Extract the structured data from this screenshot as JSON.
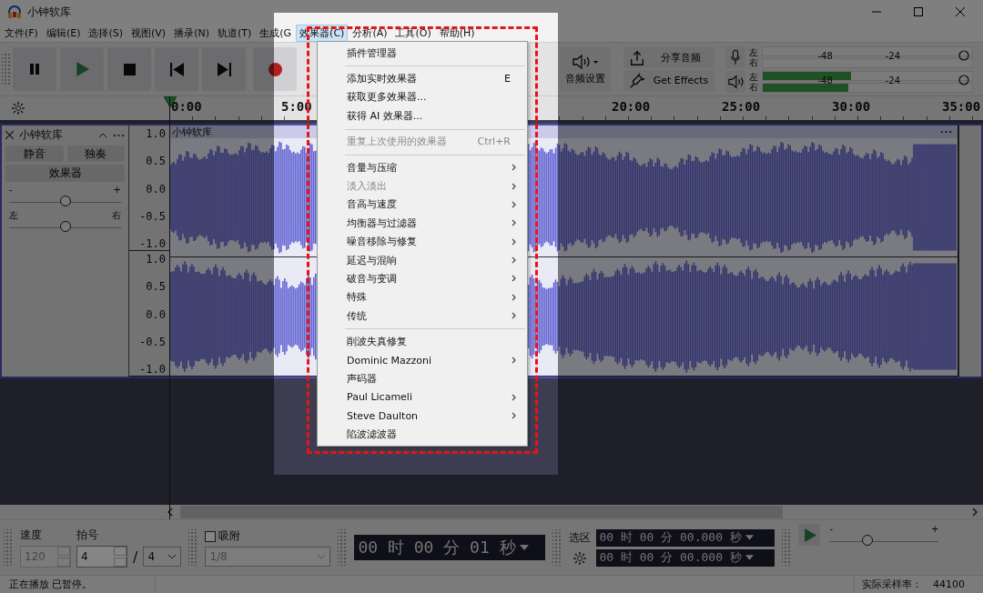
{
  "window": {
    "title": "小钟软库"
  },
  "menubar": [
    {
      "label": "文件(F)",
      "selected": false
    },
    {
      "label": "编辑(E)",
      "selected": false
    },
    {
      "label": "选择(S)",
      "selected": false
    },
    {
      "label": "视图(V)",
      "selected": false
    },
    {
      "label": "播录(N)",
      "selected": false
    },
    {
      "label": "轨道(T)",
      "selected": false
    },
    {
      "label": "生成(G",
      "selected": false
    },
    {
      "label": "效果器(C)",
      "selected": true
    },
    {
      "label": "分析(A)",
      "selected": false
    },
    {
      "label": "工具(O)",
      "selected": false
    },
    {
      "label": "帮助(H)",
      "selected": false
    }
  ],
  "transport": [
    {
      "kind": "pause"
    },
    {
      "kind": "play"
    },
    {
      "kind": "stop"
    },
    {
      "kind": "skip_start"
    },
    {
      "kind": "skip_end"
    },
    {
      "kind": "record"
    }
  ],
  "audio_setup": {
    "label": "音频设置"
  },
  "share": {
    "label": "分享音频"
  },
  "get_effects": {
    "label": "Get Effects"
  },
  "record_meter": {
    "channels": [
      {
        "label": "左"
      },
      {
        "label": "右"
      }
    ],
    "ticks": [
      "-48",
      "-24"
    ]
  },
  "play_meter": {
    "channels": [
      {
        "label": "左",
        "level": 0.42
      },
      {
        "label": "右",
        "level": 0.41
      }
    ],
    "ticks": [
      "-48",
      "-24"
    ]
  },
  "ruler": {
    "labels": [
      "0:00",
      "5:00",
      "20:00",
      "25:00",
      "30:00",
      "35:00"
    ]
  },
  "track": {
    "name": "小钟软库",
    "buttons": [
      "静音",
      "独奏"
    ],
    "effects_button": "效果器",
    "gain": {
      "min": "-",
      "max": "+",
      "level": 0.5
    },
    "pan": {
      "min": "左",
      "max": "右",
      "level": 0.5
    },
    "channels": [
      {
        "scale": [
          "1.0",
          "0.5",
          "0.0",
          "-0.5",
          "-1.0"
        ]
      },
      {
        "scale": [
          "1.0",
          "0.5",
          "0.0",
          "-0.5",
          "-1.0"
        ]
      }
    ],
    "clip_title": "小钟软库"
  },
  "effects_menu": {
    "groups": [
      [
        {
          "label": "插件管理器",
          "submenu": false,
          "disabled": false
        }
      ],
      [
        {
          "label": "添加实时效果器",
          "shortcut": "E",
          "submenu": false,
          "disabled": false
        },
        {
          "label": "获取更多效果器...",
          "submenu": false,
          "disabled": false
        },
        {
          "label": "获得 AI 效果器...",
          "submenu": false,
          "disabled": false
        }
      ],
      [
        {
          "label": "重复上次使用的效果器",
          "shortcut": "Ctrl+R",
          "submenu": false,
          "disabled": true
        }
      ],
      [
        {
          "label": "音量与压缩",
          "submenu": true,
          "disabled": false
        },
        {
          "label": "淡入淡出",
          "submenu": true,
          "disabled": true
        },
        {
          "label": "音高与速度",
          "submenu": true,
          "disabled": false
        },
        {
          "label": "均衡器与过滤器",
          "submenu": true,
          "disabled": false
        },
        {
          "label": "噪音移除与修复",
          "submenu": true,
          "disabled": false
        },
        {
          "label": "延迟与混响",
          "submenu": true,
          "disabled": false
        },
        {
          "label": "破音与变调",
          "submenu": true,
          "disabled": false
        },
        {
          "label": "特殊",
          "submenu": true,
          "disabled": false
        },
        {
          "label": "传统",
          "submenu": true,
          "disabled": false
        }
      ],
      [
        {
          "label": "削波失真修复",
          "submenu": false,
          "disabled": false
        },
        {
          "label": "Dominic Mazzoni",
          "submenu": true,
          "disabled": false
        },
        {
          "label": "声码器",
          "submenu": false,
          "disabled": false
        },
        {
          "label": "Paul Licameli",
          "submenu": true,
          "disabled": false
        },
        {
          "label": "Steve Daulton",
          "submenu": true,
          "disabled": false
        },
        {
          "label": "陷波滤波器",
          "submenu": false,
          "disabled": false
        }
      ]
    ]
  },
  "bottom": {
    "tempo": {
      "label": "速度",
      "value": "120",
      "disabled": true
    },
    "time_signature": {
      "label": "拍号",
      "upper": "4",
      "separator": "/",
      "lower": "4"
    },
    "snap": {
      "label": "吸附",
      "checked": false,
      "value": "1/8",
      "disabled": true
    },
    "time": "00 时 00 分 01 秒",
    "selection": {
      "label": "选区",
      "start": "00 时 00 分 00.000 秒",
      "end": "00 时 00 分 00.000 秒"
    },
    "play_speed": {
      "min": "-",
      "max": "+",
      "level": 0.35
    }
  },
  "status_bar": {
    "left": "正在播放 已暂停。",
    "rate_label": "实际采样率：",
    "rate_value": "44100"
  }
}
